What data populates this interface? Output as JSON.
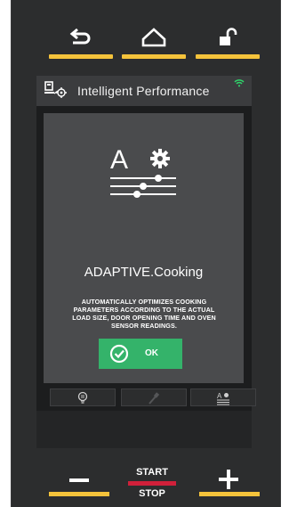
{
  "nav": {
    "back_icon": "back-arrow-icon",
    "home_icon": "home-icon",
    "lock_icon": "unlock-icon"
  },
  "header": {
    "icon": "intelligent-performance-icon",
    "title": "Intelligent Performance",
    "status_icon": "wifi-icon"
  },
  "dialog": {
    "icon": "adaptive-cooking-icon",
    "icon_letter": "A",
    "title": "ADAPTIVE.Cooking",
    "description": "AUTOMATICALLY OPTIMIZES COOKING PARAMETERS ACCORDING TO THE ACTUAL LOAD SIZE, DOOR OPENING TIME AND OVEN SENSOR READINGS.",
    "ok_label": "OK",
    "ok_icon": "check-circle-icon"
  },
  "tabs": [
    {
      "icon": "lightbulb-icon"
    },
    {
      "icon": "probe-icon"
    },
    {
      "icon": "adaptive-settings-icon"
    }
  ],
  "controls": {
    "minus_icon": "minus-icon",
    "plus_icon": "plus-icon",
    "start_label": "START",
    "stop_label": "STOP"
  },
  "colors": {
    "accent_yellow": "#f5c33b",
    "ok_green": "#34b36a",
    "stop_red": "#d0203a",
    "wifi_green": "#2fd36a"
  }
}
